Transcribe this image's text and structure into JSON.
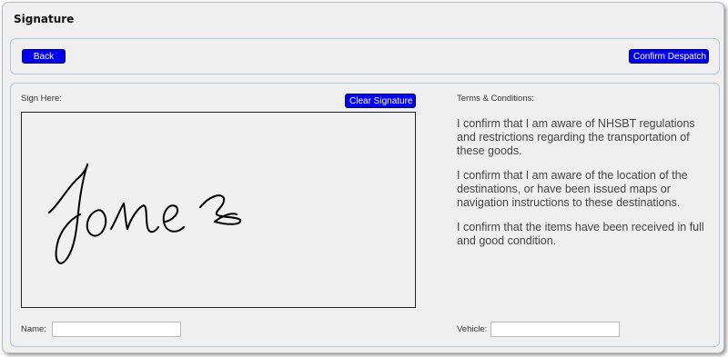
{
  "window": {
    "title": "Signature"
  },
  "toolbar": {
    "back_label": "Back",
    "confirm_label": "Confirm Despatch"
  },
  "signature": {
    "label": "Sign Here:",
    "clear_label": "Clear Signature",
    "drawn_signature_text": "Jones"
  },
  "terms": {
    "label": "Terms & Conditions:",
    "paragraphs": [
      "I confirm that I am aware of NHSBT regulations and restrictions regarding the transportation of these goods.",
      "I confirm that I am aware of the location of the destinations, or have been issued maps or navigation instructions to these destinations.",
      "I confirm that the items have been received in full and good condition."
    ]
  },
  "form": {
    "name_label": "Name:",
    "name_value": "",
    "vehicle_label": "Vehicle:",
    "vehicle_value": ""
  },
  "colors": {
    "button_bg": "#0000ee",
    "panel_border": "#b3c6dd",
    "background": "#f0f0f0"
  }
}
